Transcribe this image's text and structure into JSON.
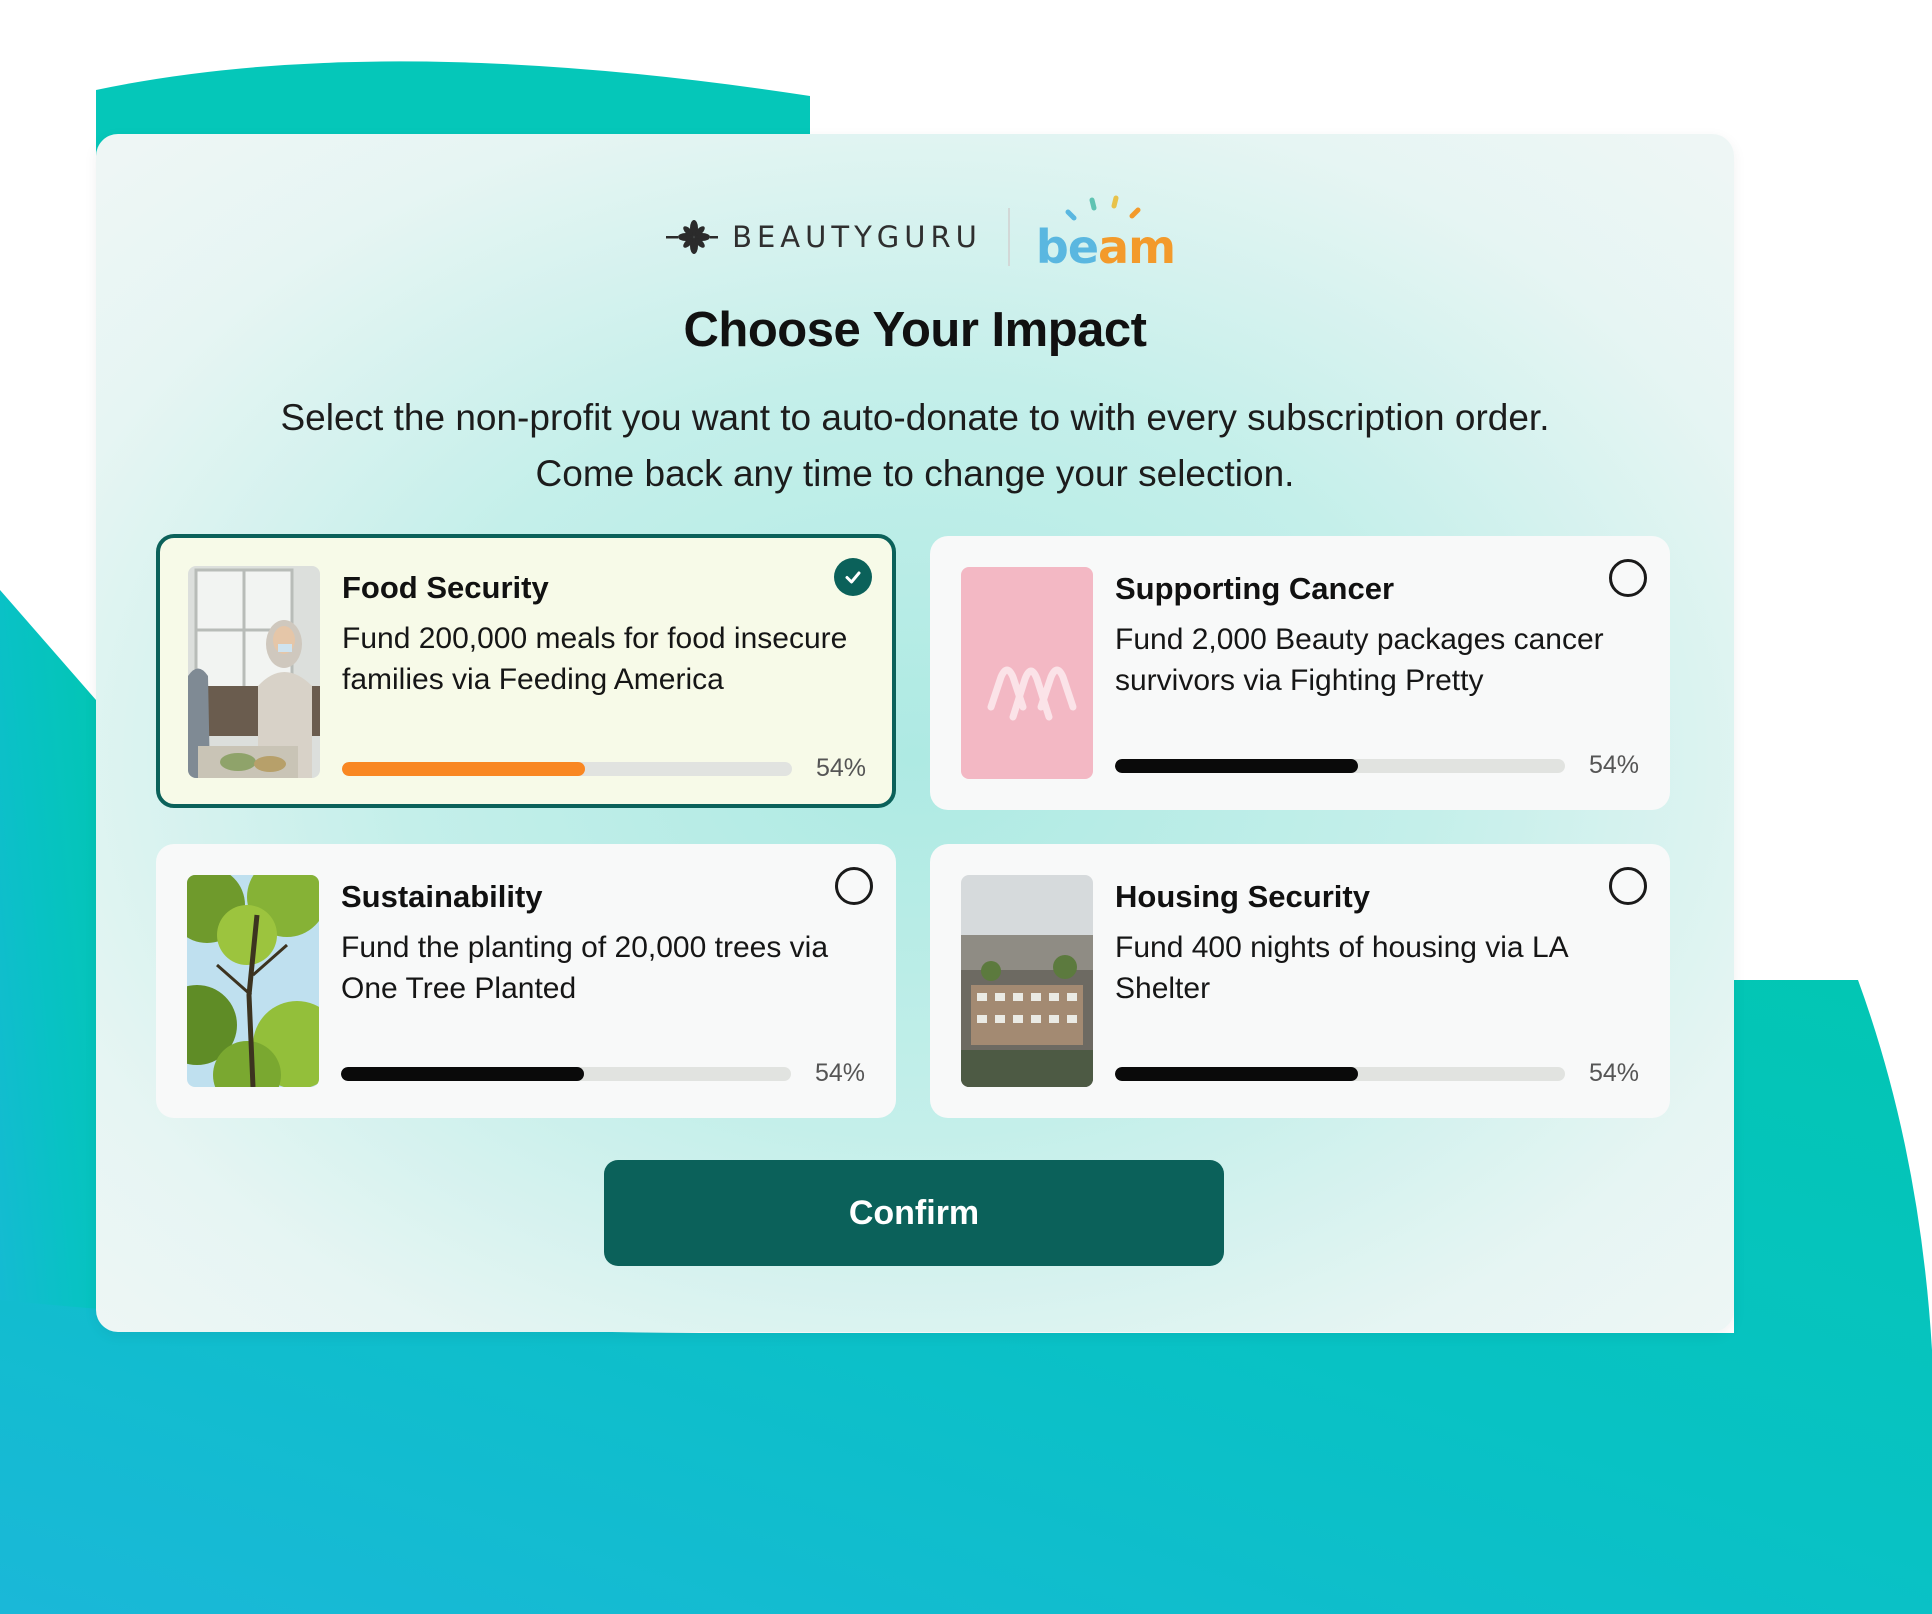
{
  "brand": {
    "partner_name": "BEAUTYGURU",
    "platform_name": "beam",
    "platform_colors": [
      "#5ab7e0",
      "#f39a2b",
      "#e8c24a"
    ]
  },
  "header": {
    "title": "Choose Your Impact",
    "subtitle_line1": "Select the non-profit you want to auto-donate to with every subscription order.",
    "subtitle_line2": "Come back any time to change your selection."
  },
  "cards": [
    {
      "title": "Food Security",
      "description": "Fund 200,000 meals for food insecure families via Feeding America",
      "progress": 0.54,
      "progress_label": "54%",
      "selected": true,
      "bar_color": "#f98722",
      "image": "volunteers-serving-food-image"
    },
    {
      "title": "Supporting Cancer",
      "description": "Fund 2,000 Beauty packages cancer survivors via Fighting Pretty",
      "progress": 0.54,
      "progress_label": "54%",
      "selected": false,
      "bar_color": "#0a0a0a",
      "image": "pink-ribbons-image"
    },
    {
      "title": "Sustainability",
      "description": "Fund the planting of 20,000 trees via One Tree Planted",
      "progress": 0.54,
      "progress_label": "54%",
      "selected": false,
      "bar_color": "#0a0a0a",
      "image": "tree-canopy-image"
    },
    {
      "title": "Housing Security",
      "description": "Fund 400 nights of housing via LA Shelter",
      "progress": 0.54,
      "progress_label": "54%",
      "selected": false,
      "bar_color": "#0a0a0a",
      "image": "city-housing-image"
    }
  ],
  "actions": {
    "confirm_label": "Confirm"
  },
  "colors": {
    "accent": "#0b615a",
    "teal_background": "#05c7b9",
    "selected_card_bg": "#f7fae8"
  }
}
